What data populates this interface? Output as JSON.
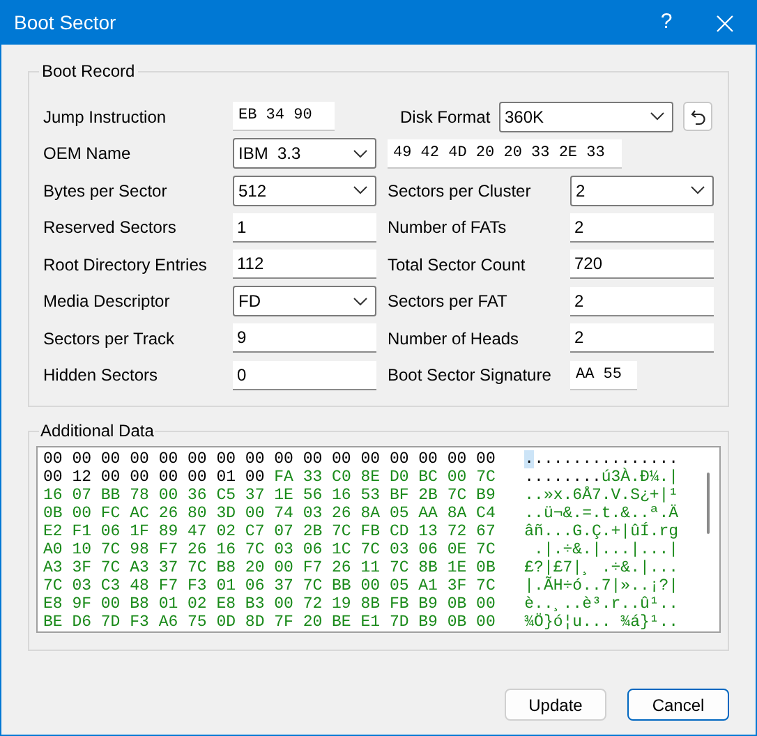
{
  "window": {
    "title": "Boot Sector",
    "help": "?"
  },
  "boot_record": {
    "title": "Boot Record",
    "rows": [
      {
        "left": {
          "label": "Jump Instruction",
          "kind": "mono",
          "value": "EB 34 90"
        },
        "right": {
          "label": "Disk Format",
          "kind": "combo",
          "value": "360K"
        }
      },
      {
        "left": {
          "label": "OEM Name",
          "kind": "select",
          "value": "IBM  3.3"
        },
        "right": {
          "kind": "monowide",
          "value": "49 42 4D 20 20 33 2E 33"
        }
      },
      {
        "left": {
          "label": "Bytes per Sector",
          "kind": "select",
          "value": "512"
        },
        "right": {
          "label": "Sectors per Cluster",
          "kind": "select",
          "value": "2"
        }
      },
      {
        "left": {
          "label": "Reserved Sectors",
          "kind": "text",
          "value": "1"
        },
        "right": {
          "label": "Number of FATs",
          "kind": "text",
          "value": "2"
        }
      },
      {
        "left": {
          "label": "Root Directory Entries",
          "kind": "text",
          "value": "112"
        },
        "right": {
          "label": "Total Sector Count",
          "kind": "text",
          "value": "720"
        }
      },
      {
        "left": {
          "label": "Media Descriptor",
          "kind": "select",
          "value": "FD"
        },
        "right": {
          "label": "Sectors per FAT",
          "kind": "text",
          "value": "2"
        }
      },
      {
        "left": {
          "label": "Sectors per Track",
          "kind": "text",
          "value": "9"
        },
        "right": {
          "label": "Number of Heads",
          "kind": "text",
          "value": "2"
        }
      },
      {
        "left": {
          "label": "Hidden Sectors",
          "kind": "text",
          "value": "0"
        },
        "right": {
          "label": "Boot Sector Signature",
          "kind": "mono",
          "value": "AA 55"
        }
      }
    ]
  },
  "additional_data": {
    "title": "Additional Data",
    "rows": [
      {
        "hex": [
          {
            "text": "00 00 00 00 00 00 00 00 00 00 00 00 00 00 00 00",
            "kind": "plain"
          }
        ],
        "ascii": [
          {
            "text": ".",
            "kind": "cursor"
          },
          {
            "text": "...............",
            "kind": "plain"
          }
        ]
      },
      {
        "hex": [
          {
            "text": "00 12 00 00 00 00 01 00 ",
            "kind": "plain"
          },
          {
            "text": "FA 33 C0 8E D0 BC 00 7C",
            "kind": "code"
          }
        ],
        "ascii": [
          {
            "text": "........",
            "kind": "plain"
          },
          {
            "text": "ú3À.Ð¼.|",
            "kind": "code"
          }
        ]
      },
      {
        "hex": [
          {
            "text": "16 07 BB 78 00 36 C5 37 1E 56 16 53 BF 2B 7C B9",
            "kind": "code"
          }
        ],
        "ascii": [
          {
            "text": "..»x.6Å7.V.S¿+|¹",
            "kind": "code"
          }
        ]
      },
      {
        "hex": [
          {
            "text": "0B 00 FC AC 26 80 3D 00 74 03 26 8A 05 AA 8A C4",
            "kind": "code"
          }
        ],
        "ascii": [
          {
            "text": "..ü¬&.=.t.&..ª.Ä",
            "kind": "code"
          }
        ]
      },
      {
        "hex": [
          {
            "text": "E2 F1 06 1F 89 47 02 C7 07 2B 7C FB CD 13 72 67",
            "kind": "code"
          }
        ],
        "ascii": [
          {
            "text": "âñ...G.Ç.+|ûÍ.rg",
            "kind": "code"
          }
        ]
      },
      {
        "hex": [
          {
            "text": "A0 10 7C 98 F7 26 16 7C 03 06 1C 7C 03 06 0E 7C",
            "kind": "code"
          }
        ],
        "ascii": [
          {
            "text": " .|.÷&.|...|...|",
            "kind": "code"
          }
        ]
      },
      {
        "hex": [
          {
            "text": "A3 3F 7C A3 37 7C B8 20 00 F7 26 11 7C 8B 1E 0B",
            "kind": "code"
          }
        ],
        "ascii": [
          {
            "text": "£?|£7|¸ .÷&.|...",
            "kind": "code"
          }
        ]
      },
      {
        "hex": [
          {
            "text": "7C 03 C3 48 F7 F3 01 06 37 7C BB 00 05 A1 3F 7C",
            "kind": "code"
          }
        ],
        "ascii": [
          {
            "text": "|.ÃH÷ó..7|»..¡?|",
            "kind": "code"
          }
        ]
      },
      {
        "hex": [
          {
            "text": "E8 9F 00 B8 01 02 E8 B3 00 72 19 8B FB B9 0B 00",
            "kind": "code"
          }
        ],
        "ascii": [
          {
            "text": "è..¸..è³.r..û¹..",
            "kind": "code"
          }
        ]
      },
      {
        "hex": [
          {
            "text": "BE D6 7D F3 A6 75 0D 8D 7F 20 BE E1 7D B9 0B 00",
            "kind": "code"
          }
        ],
        "ascii": [
          {
            "text": "¾Ö}ó¦u... ¾á}¹..",
            "kind": "code"
          }
        ]
      }
    ]
  },
  "buttons": [
    {
      "label": "Update",
      "default": false
    },
    {
      "label": "Cancel",
      "default": true
    }
  ]
}
